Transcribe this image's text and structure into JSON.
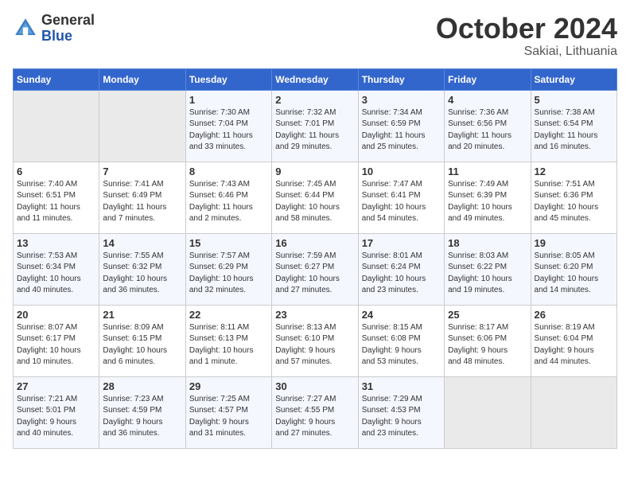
{
  "header": {
    "logo_general": "General",
    "logo_blue": "Blue",
    "month": "October 2024",
    "location": "Sakiai, Lithuania"
  },
  "weekdays": [
    "Sunday",
    "Monday",
    "Tuesday",
    "Wednesday",
    "Thursday",
    "Friday",
    "Saturday"
  ],
  "weeks": [
    [
      {
        "day": "",
        "info": ""
      },
      {
        "day": "",
        "info": ""
      },
      {
        "day": "1",
        "info": "Sunrise: 7:30 AM\nSunset: 7:04 PM\nDaylight: 11 hours\nand 33 minutes."
      },
      {
        "day": "2",
        "info": "Sunrise: 7:32 AM\nSunset: 7:01 PM\nDaylight: 11 hours\nand 29 minutes."
      },
      {
        "day": "3",
        "info": "Sunrise: 7:34 AM\nSunset: 6:59 PM\nDaylight: 11 hours\nand 25 minutes."
      },
      {
        "day": "4",
        "info": "Sunrise: 7:36 AM\nSunset: 6:56 PM\nDaylight: 11 hours\nand 20 minutes."
      },
      {
        "day": "5",
        "info": "Sunrise: 7:38 AM\nSunset: 6:54 PM\nDaylight: 11 hours\nand 16 minutes."
      }
    ],
    [
      {
        "day": "6",
        "info": "Sunrise: 7:40 AM\nSunset: 6:51 PM\nDaylight: 11 hours\nand 11 minutes."
      },
      {
        "day": "7",
        "info": "Sunrise: 7:41 AM\nSunset: 6:49 PM\nDaylight: 11 hours\nand 7 minutes."
      },
      {
        "day": "8",
        "info": "Sunrise: 7:43 AM\nSunset: 6:46 PM\nDaylight: 11 hours\nand 2 minutes."
      },
      {
        "day": "9",
        "info": "Sunrise: 7:45 AM\nSunset: 6:44 PM\nDaylight: 10 hours\nand 58 minutes."
      },
      {
        "day": "10",
        "info": "Sunrise: 7:47 AM\nSunset: 6:41 PM\nDaylight: 10 hours\nand 54 minutes."
      },
      {
        "day": "11",
        "info": "Sunrise: 7:49 AM\nSunset: 6:39 PM\nDaylight: 10 hours\nand 49 minutes."
      },
      {
        "day": "12",
        "info": "Sunrise: 7:51 AM\nSunset: 6:36 PM\nDaylight: 10 hours\nand 45 minutes."
      }
    ],
    [
      {
        "day": "13",
        "info": "Sunrise: 7:53 AM\nSunset: 6:34 PM\nDaylight: 10 hours\nand 40 minutes."
      },
      {
        "day": "14",
        "info": "Sunrise: 7:55 AM\nSunset: 6:32 PM\nDaylight: 10 hours\nand 36 minutes."
      },
      {
        "day": "15",
        "info": "Sunrise: 7:57 AM\nSunset: 6:29 PM\nDaylight: 10 hours\nand 32 minutes."
      },
      {
        "day": "16",
        "info": "Sunrise: 7:59 AM\nSunset: 6:27 PM\nDaylight: 10 hours\nand 27 minutes."
      },
      {
        "day": "17",
        "info": "Sunrise: 8:01 AM\nSunset: 6:24 PM\nDaylight: 10 hours\nand 23 minutes."
      },
      {
        "day": "18",
        "info": "Sunrise: 8:03 AM\nSunset: 6:22 PM\nDaylight: 10 hours\nand 19 minutes."
      },
      {
        "day": "19",
        "info": "Sunrise: 8:05 AM\nSunset: 6:20 PM\nDaylight: 10 hours\nand 14 minutes."
      }
    ],
    [
      {
        "day": "20",
        "info": "Sunrise: 8:07 AM\nSunset: 6:17 PM\nDaylight: 10 hours\nand 10 minutes."
      },
      {
        "day": "21",
        "info": "Sunrise: 8:09 AM\nSunset: 6:15 PM\nDaylight: 10 hours\nand 6 minutes."
      },
      {
        "day": "22",
        "info": "Sunrise: 8:11 AM\nSunset: 6:13 PM\nDaylight: 10 hours\nand 1 minute."
      },
      {
        "day": "23",
        "info": "Sunrise: 8:13 AM\nSunset: 6:10 PM\nDaylight: 9 hours\nand 57 minutes."
      },
      {
        "day": "24",
        "info": "Sunrise: 8:15 AM\nSunset: 6:08 PM\nDaylight: 9 hours\nand 53 minutes."
      },
      {
        "day": "25",
        "info": "Sunrise: 8:17 AM\nSunset: 6:06 PM\nDaylight: 9 hours\nand 48 minutes."
      },
      {
        "day": "26",
        "info": "Sunrise: 8:19 AM\nSunset: 6:04 PM\nDaylight: 9 hours\nand 44 minutes."
      }
    ],
    [
      {
        "day": "27",
        "info": "Sunrise: 7:21 AM\nSunset: 5:01 PM\nDaylight: 9 hours\nand 40 minutes."
      },
      {
        "day": "28",
        "info": "Sunrise: 7:23 AM\nSunset: 4:59 PM\nDaylight: 9 hours\nand 36 minutes."
      },
      {
        "day": "29",
        "info": "Sunrise: 7:25 AM\nSunset: 4:57 PM\nDaylight: 9 hours\nand 31 minutes."
      },
      {
        "day": "30",
        "info": "Sunrise: 7:27 AM\nSunset: 4:55 PM\nDaylight: 9 hours\nand 27 minutes."
      },
      {
        "day": "31",
        "info": "Sunrise: 7:29 AM\nSunset: 4:53 PM\nDaylight: 9 hours\nand 23 minutes."
      },
      {
        "day": "",
        "info": ""
      },
      {
        "day": "",
        "info": ""
      }
    ]
  ]
}
